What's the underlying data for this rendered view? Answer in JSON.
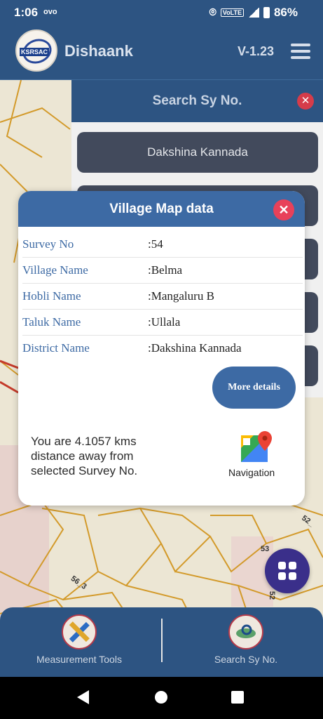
{
  "status_bar": {
    "time": "1:06",
    "carrier_icon": "ovo",
    "volte": "VoLTE",
    "net": "4G",
    "battery": "86%"
  },
  "app_bar": {
    "title": "Dishaank",
    "version": "V-1.23",
    "logo_text": "KSRSAC"
  },
  "search_sheet": {
    "title": "Search Sy No.",
    "items": [
      "Dakshina Kannada"
    ]
  },
  "map_labels": [
    "53",
    "52_",
    "56_3",
    "52"
  ],
  "dialog": {
    "title": "Village Map data",
    "rows": [
      {
        "label": "Survey No",
        "value": ":54"
      },
      {
        "label": "Village Name",
        "value": ":Belma"
      },
      {
        "label": "Hobli Name",
        "value": ":Mangaluru B"
      },
      {
        "label": "Taluk Name",
        "value": ":Ullala"
      },
      {
        "label": "District Name",
        "value": ":Dakshina Kannada"
      }
    ],
    "more_button": "More details",
    "distance_text": "You are 4.1057 kms distance away from selected Survey No.",
    "navigation_label": "Navigation"
  },
  "bottom_bar": {
    "left_label": "Measurement Tools",
    "right_label": "Search Sy No."
  },
  "colors": {
    "primary": "#2d5482",
    "accent": "#3d6aa4",
    "close": "#e8415a",
    "fab": "#3a2f8a"
  }
}
